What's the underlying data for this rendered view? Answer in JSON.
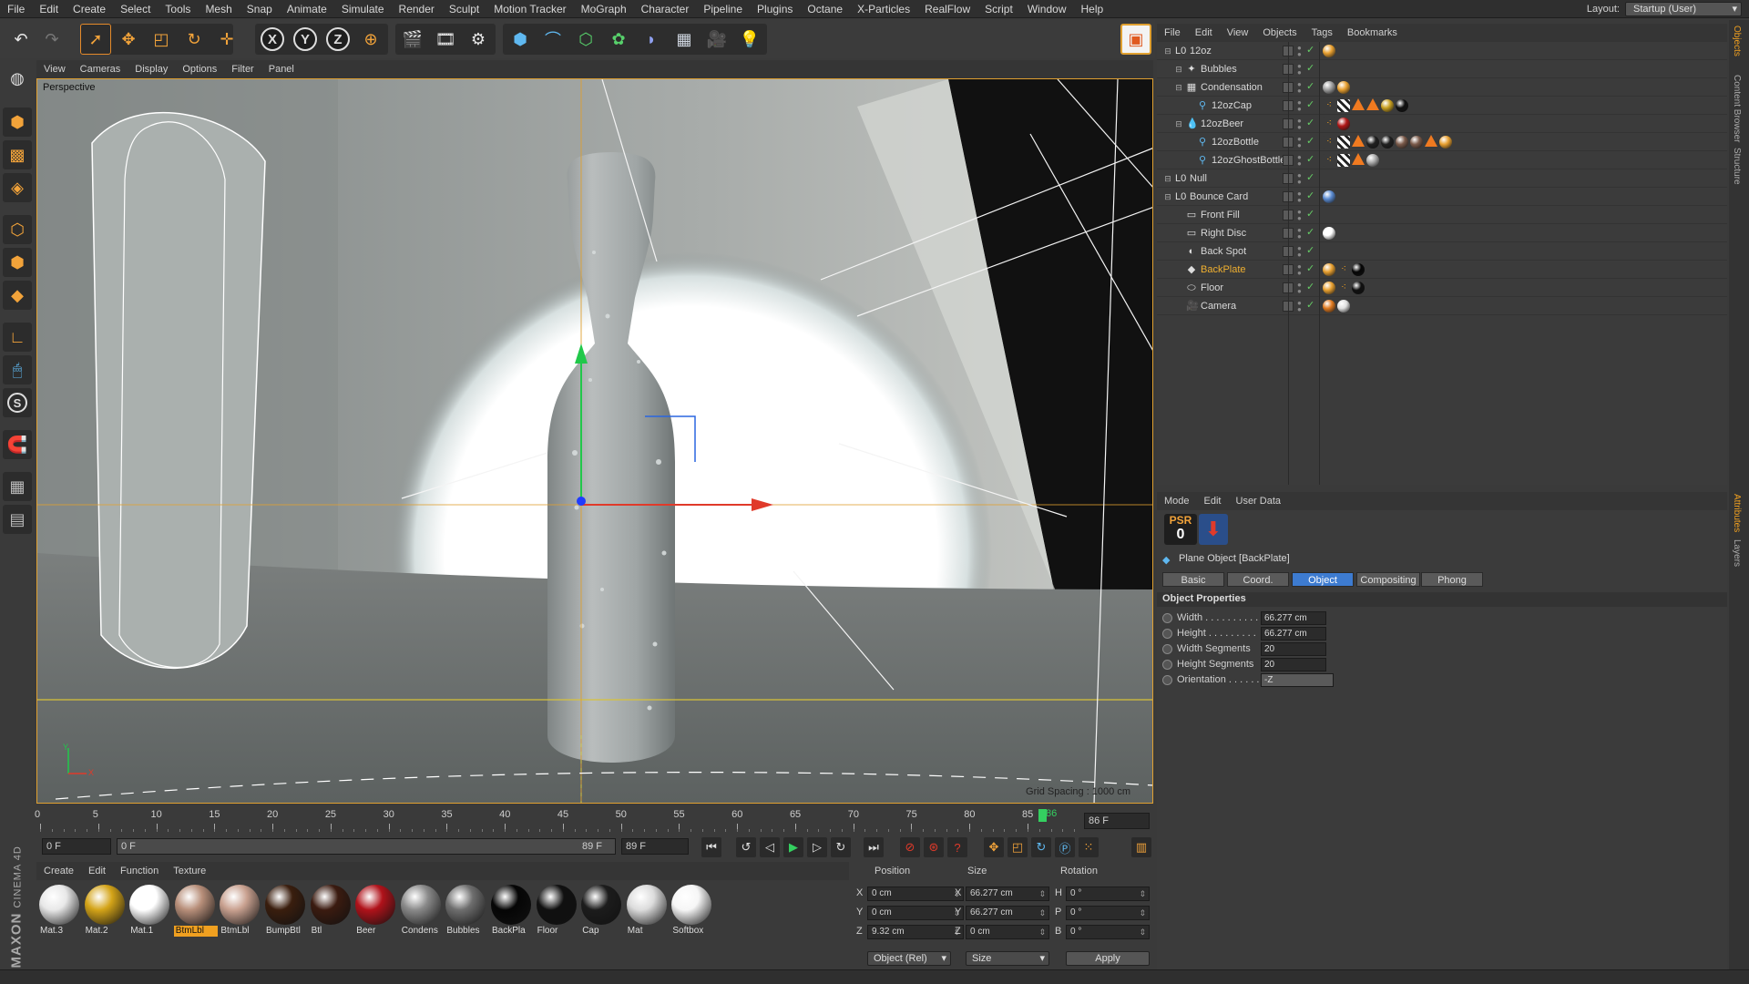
{
  "menubar": {
    "items": [
      "File",
      "Edit",
      "Create",
      "Select",
      "Tools",
      "Mesh",
      "Snap",
      "Animate",
      "Simulate",
      "Render",
      "Sculpt",
      "Motion Tracker",
      "MoGraph",
      "Character",
      "Pipeline",
      "Plugins",
      "Octane",
      "X-Particles",
      "RealFlow",
      "Script",
      "Window",
      "Help"
    ],
    "layout_label": "Layout:",
    "layout_value": "Startup (User)"
  },
  "toolbar": {
    "axis_x": "X",
    "axis_y": "Y",
    "axis_z": "Z"
  },
  "left_tools": {
    "s_label": "S"
  },
  "viewport": {
    "menu": [
      "View",
      "Cameras",
      "Display",
      "Options",
      "Filter",
      "Panel"
    ],
    "label": "Perspective",
    "grid_spacing": "Grid Spacing : 1000 cm",
    "axis_y": "Y",
    "axis_x": "X"
  },
  "timeline": {
    "ticks": [
      "0",
      "5",
      "10",
      "15",
      "20",
      "25",
      "30",
      "35",
      "40",
      "45",
      "50",
      "55",
      "60",
      "65",
      "70",
      "75",
      "80",
      "85"
    ],
    "current_frame_marker": "86",
    "current_frame_field": "86 F",
    "start_field": "0 F",
    "range_start": "0 F",
    "range_end": "89 F",
    "end_field": "89 F"
  },
  "materials": {
    "menu": [
      "Create",
      "Edit",
      "Function",
      "Texture"
    ],
    "items": [
      {
        "label": "Mat.3",
        "color": "#e8e8e8"
      },
      {
        "label": "Mat.2",
        "color": "#d4a418"
      },
      {
        "label": "Mat.1",
        "color": "#ffffff"
      },
      {
        "label": "BtmLbl",
        "color": "#b88f7a",
        "selected": true
      },
      {
        "label": "BtmLbl",
        "color": "#c9a190"
      },
      {
        "label": "BumpBtl",
        "color": "#3a1e0e"
      },
      {
        "label": "Btl",
        "color": "#3b1b10"
      },
      {
        "label": "Beer",
        "color": "#b0121a"
      },
      {
        "label": "Condens",
        "color": "#8a8a8a"
      },
      {
        "label": "Bubbles",
        "color": "#6e6e6e"
      },
      {
        "label": "BackPla",
        "color": "#050505"
      },
      {
        "label": "Floor",
        "color": "#101010"
      },
      {
        "label": "Cap",
        "color": "#1c1c1c"
      },
      {
        "label": "Mat",
        "color": "#dcdcdc"
      },
      {
        "label": "Softbox",
        "color": "#f6f6f6"
      }
    ]
  },
  "coords": {
    "headers": [
      "Position",
      "Size",
      "Rotation"
    ],
    "axes_pos": [
      "X",
      "Y",
      "Z"
    ],
    "axes_size": [
      "X",
      "Y",
      "Z"
    ],
    "axes_rot": [
      "H",
      "P",
      "B"
    ],
    "position": [
      "0 cm",
      "0 cm",
      "9.32 cm"
    ],
    "size": [
      "66.277 cm",
      "66.277 cm",
      "0 cm"
    ],
    "rotation": [
      "0 °",
      "0 °",
      "0 °"
    ],
    "mode": "Object (Rel)",
    "size_mode": "Size",
    "apply": "Apply"
  },
  "brand": {
    "line1": "MAXON",
    "line2": "CINEMA 4D"
  },
  "objects": {
    "menu": [
      "File",
      "Edit",
      "View",
      "Objects",
      "Tags",
      "Bookmarks"
    ],
    "rows": [
      {
        "name": "12oz",
        "indent": 0,
        "icon": "null-icon"
      },
      {
        "name": "Bubbles",
        "indent": 1,
        "icon": "particles-icon"
      },
      {
        "name": "Condensation",
        "indent": 1,
        "icon": "cloner-icon"
      },
      {
        "name": "12ozCap",
        "indent": 2,
        "icon": "lathe-icon"
      },
      {
        "name": "12ozBeer",
        "indent": 1,
        "icon": "liquid-icon"
      },
      {
        "name": "12ozBottle",
        "indent": 2,
        "icon": "lathe-icon"
      },
      {
        "name": "12ozGhostBottle",
        "indent": 2,
        "icon": "lathe-icon"
      },
      {
        "name": "Null",
        "indent": 0,
        "icon": "null-icon"
      },
      {
        "name": "Bounce Card",
        "indent": 0,
        "icon": "null-icon"
      },
      {
        "name": "Front Fill",
        "indent": 1,
        "icon": "area-light-icon"
      },
      {
        "name": "Right Disc",
        "indent": 1,
        "icon": "area-light-icon"
      },
      {
        "name": "Back Spot",
        "indent": 1,
        "icon": "spot-light-icon"
      },
      {
        "name": "BackPlate",
        "indent": 1,
        "icon": "plane-icon",
        "highlight": true
      },
      {
        "name": "Floor",
        "indent": 1,
        "icon": "disc-icon"
      },
      {
        "name": "Camera",
        "indent": 1,
        "icon": "camera-icon"
      }
    ]
  },
  "attributes": {
    "menu": [
      "Mode",
      "Edit",
      "User Data"
    ],
    "psr_label": "PSR",
    "psr_value": "0",
    "object_title": "Plane Object [BackPlate]",
    "tabs": [
      "Basic",
      "Coord.",
      "Object",
      "Compositing",
      "Phong"
    ],
    "active_tab": "Object",
    "section": "Object Properties",
    "props": [
      {
        "label": "Width . . . . . . . . . .",
        "value": "66.277 cm"
      },
      {
        "label": "Height . . . . . . . . .",
        "value": "66.277 cm"
      },
      {
        "label": "Width Segments",
        "value": "20"
      },
      {
        "label": "Height Segments",
        "value": "20"
      },
      {
        "label": "Orientation . . . . . .",
        "value": "-Z"
      }
    ]
  },
  "right_strip": [
    "Objects",
    "Content Browser",
    "Structure",
    "Attributes",
    "Layers"
  ],
  "colors": {
    "accent": "#f0a020",
    "selection_blue": "#3d7bd0"
  }
}
